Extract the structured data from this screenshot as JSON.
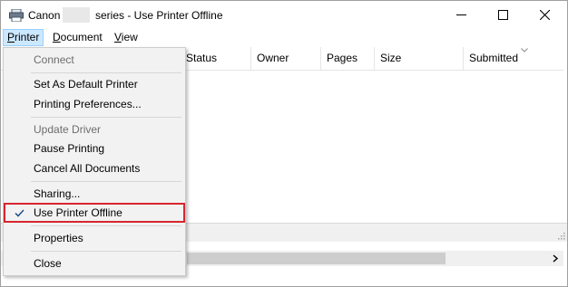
{
  "window": {
    "title_prefix": "Canon",
    "title_suffix": "series  -  Use Printer Offline",
    "minimize_icon": "minimize-icon",
    "maximize_icon": "maximize-icon",
    "close_icon": "close-icon"
  },
  "menubar": {
    "printer": {
      "mnemonic": "P",
      "rest": "rinter"
    },
    "document": {
      "mnemonic": "D",
      "rest": "ocument"
    },
    "view": {
      "mnemonic": "V",
      "rest": "iew"
    }
  },
  "columns": [
    "Status",
    "Owner",
    "Pages",
    "Size",
    "Submitted"
  ],
  "printer_menu": {
    "items": [
      {
        "label": "Connect",
        "enabled": false
      },
      {
        "label": "Set As Default Printer",
        "enabled": true
      },
      {
        "label": "Printing Preferences...",
        "enabled": true
      },
      {
        "label": "Update Driver",
        "enabled": false
      },
      {
        "label": "Pause Printing",
        "enabled": true
      },
      {
        "label": "Cancel All Documents",
        "enabled": true
      },
      {
        "label": "Sharing...",
        "enabled": true
      },
      {
        "label": "Use Printer Offline",
        "enabled": true,
        "checked": true,
        "highlighted": true
      },
      {
        "label": "Properties",
        "enabled": true
      },
      {
        "label": "Close",
        "enabled": true
      }
    ]
  },
  "colors": {
    "highlight_border": "#d7262f",
    "menu_active": "#cce8ff",
    "checkmark": "#1f4e8c"
  }
}
